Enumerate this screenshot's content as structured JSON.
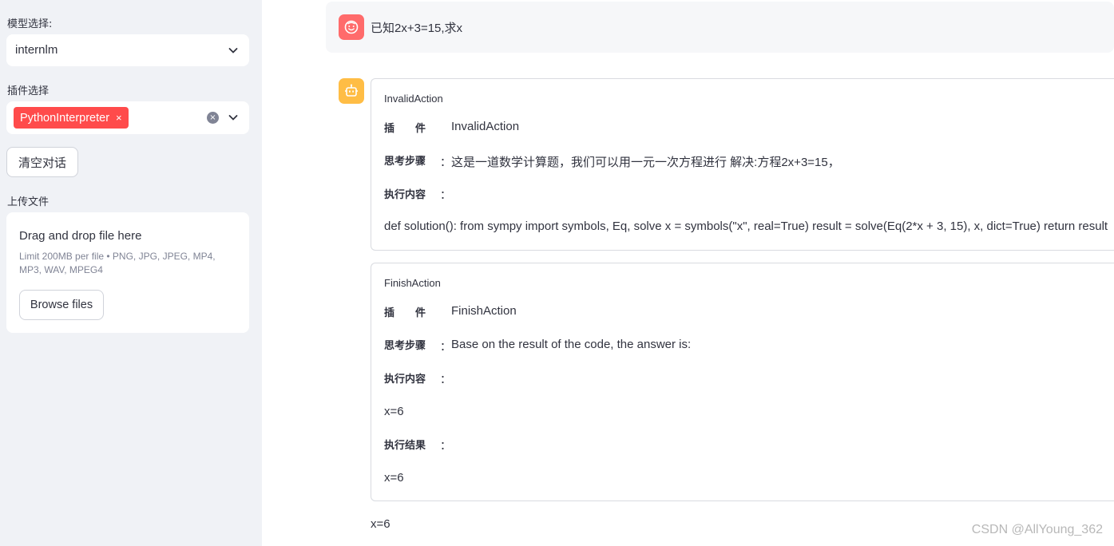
{
  "sidebar": {
    "model_label": "模型选择:",
    "model_value": "internlm",
    "plugin_label": "插件选择",
    "plugin_tag": "PythonInterpreter",
    "plugin_tag_remove": "×",
    "clear_icon": "×",
    "clear_button": "清空对话",
    "upload_label": "上传文件",
    "upload": {
      "title": "Drag and drop file here",
      "limit": "Limit 200MB per file • PNG, JPG, JPEG, MP4, MP3, WAV, MPEG4",
      "browse": "Browse files"
    }
  },
  "chat": {
    "user_message": "已知2x+3=15,求x",
    "cards": [
      {
        "title": "InvalidAction",
        "plugin_key": "插　　件",
        "plugin_val": "InvalidAction",
        "think_key": "思考步骤",
        "think_val": "这是一道数学计算题，我们可以用一元一次方程进行 解决:方程2x+3=15，",
        "exec_key": "执行内容",
        "exec_val": "def solution(): from sympy import symbols, Eq, solve x = symbols(\"x\", real=True) result = solve(Eq(2*x + 3, 15), x, dict=True) return result"
      },
      {
        "title": "FinishAction",
        "plugin_key": "插　　件",
        "plugin_val": "FinishAction",
        "think_key": "思考步骤",
        "think_val": "Base on the result of the code, the answer is:",
        "exec_key": "执行内容",
        "exec_val": "x=6",
        "result_key": "执行结果",
        "result_val": "x=6"
      }
    ],
    "colon": "：",
    "final_answer": "x=6"
  },
  "watermark": "CSDN @AllYoung_362",
  "colors": {
    "accent": "#ff4b4b",
    "user_avatar": "#ff6b6b",
    "bot_avatar": "#ffbd45",
    "sidebar_bg": "#f0f2f6"
  },
  "icons": {
    "user_avatar": "smiley-face-icon",
    "bot_avatar": "robot-icon",
    "dropdown": "chevron-down-icon",
    "clear": "clear-circle-icon"
  }
}
